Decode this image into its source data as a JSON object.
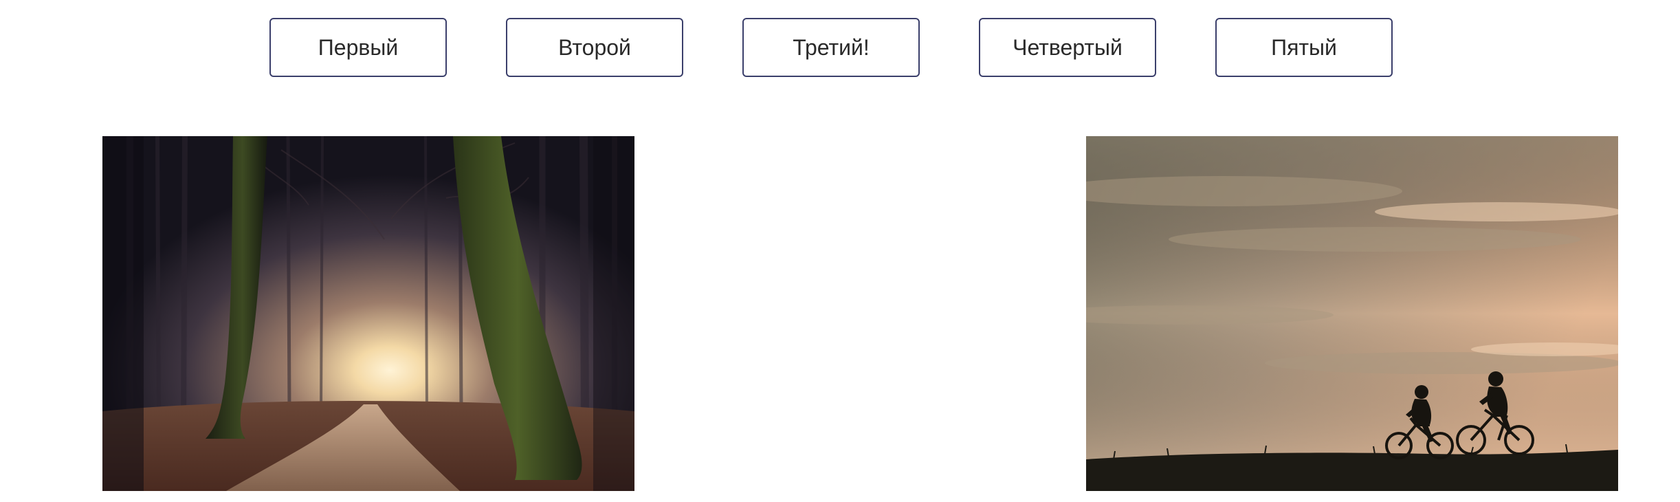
{
  "nav": {
    "buttons": [
      {
        "label": "Первый"
      },
      {
        "label": "Второй"
      },
      {
        "label": "Третий!"
      },
      {
        "label": "Четвертый"
      },
      {
        "label": "Пятый"
      }
    ]
  },
  "images": [
    {
      "subject": "misty forest path with mossy trees"
    },
    {
      "subject": "two cyclists silhouetted at sunset"
    }
  ],
  "colors": {
    "button_border": "#3b3f6b",
    "button_text": "#2a2a2a",
    "background": "#ffffff"
  }
}
